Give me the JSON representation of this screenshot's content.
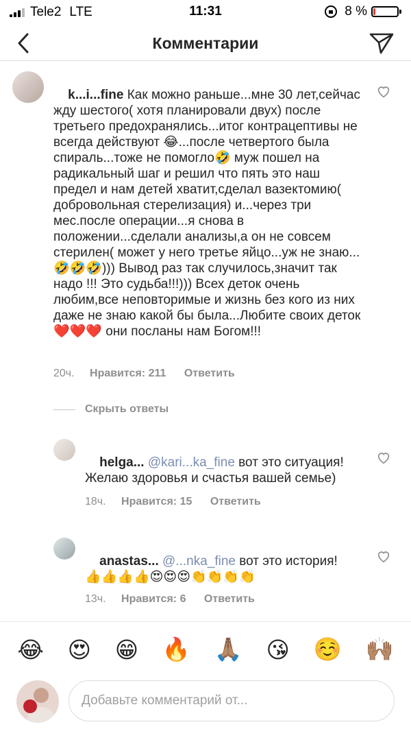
{
  "status_bar": {
    "carrier": "Tele2",
    "network": "LTE",
    "time": "11:31",
    "battery_percent": "8 %",
    "battery_level": 0.08,
    "battery_color": "#e43b2c"
  },
  "nav": {
    "title": "Комментарии"
  },
  "comments": [
    {
      "user": "k...i...fine",
      "text": "Как можно раньше...мне 30 лет,сейчас жду шестого( хотя планировали двух) после третьего предохранялись...итог контрацептивы не всегда действуют 😂...после четвертого была спираль...тоже не помогло🤣 муж пошел на радикальный шаг и решил что пять это наш предел и нам детей хватит,сделал вазектомию( добровольная стерелизация) и...через три мес.после операции...я снова в положении...сделали анализы,а он не совсем стерилен( может у него третье яйцо...уж не знаю...🤣🤣🤣))) Вывод раз так случилось,значит так надо !!! Это судьба!!!))) Всех деток очень любим,все неповторимые и жизнь без кого из них даже не знаю какой бы была...Любите своих деток❤️❤️❤️ они посланы нам Богом!!!",
      "time": "20ч.",
      "likes": "Нравится: 211",
      "reply": "Ответить"
    }
  ],
  "hide_replies": "Скрыть ответы",
  "replies": [
    {
      "user": "helga...",
      "mention": "@kari...ka_fine",
      "text": " вот это ситуация! Желаю здоровья и счастья вашей семье)",
      "time": "18ч.",
      "likes": "Нравится: 15",
      "reply": "Ответить"
    },
    {
      "user": "anastas...",
      "mention": "@...nka_fine",
      "text": " вот это история!👍👍👍👍😍😍😍👏👏👏👏",
      "time": "13ч.",
      "likes": "Нравится: 6",
      "reply": "Ответить"
    }
  ],
  "emoji_bar": [
    "😂",
    "😍",
    "😁",
    "🔥",
    "🙏🏽",
    "😘",
    "☺️",
    "🙌🏽"
  ],
  "input": {
    "placeholder": "Добавьте комментарий от..."
  }
}
